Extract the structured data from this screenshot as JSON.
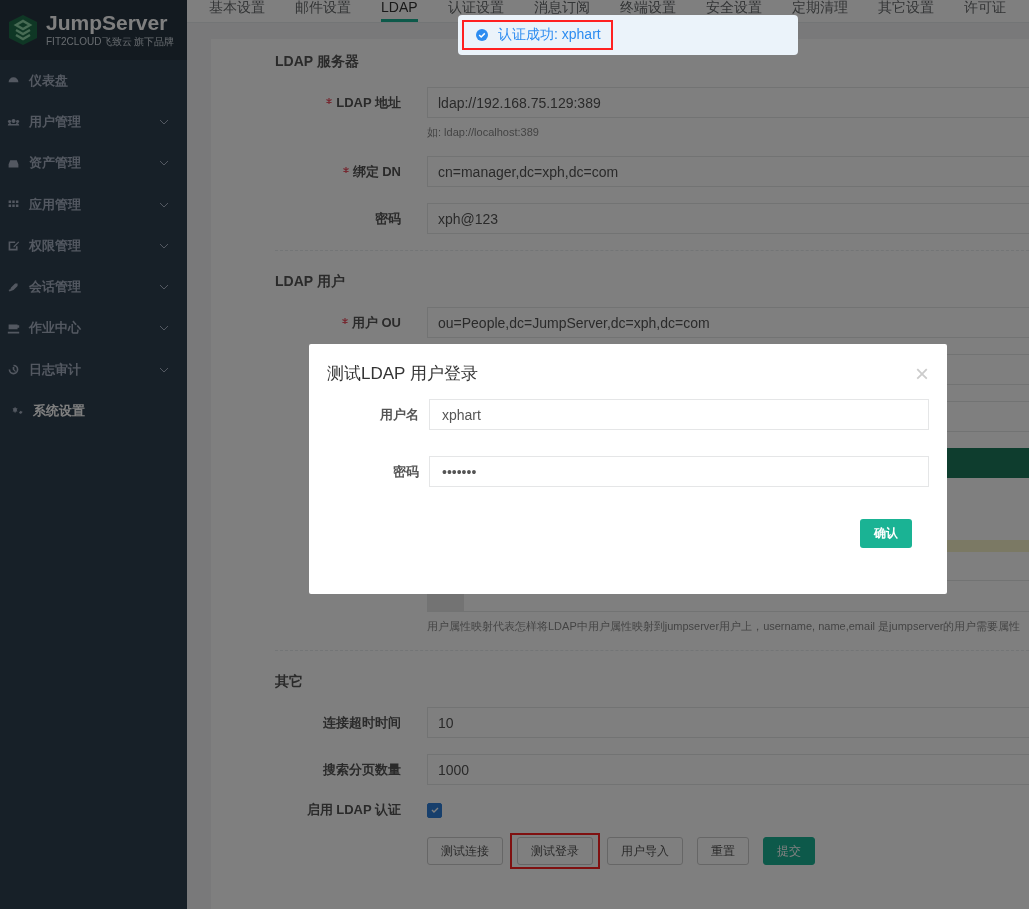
{
  "logo": {
    "name": "JumpServer",
    "tagline": "FIT2CLOUD飞致云 旗下品牌"
  },
  "sidebar": {
    "items": [
      {
        "label": "仪表盘",
        "expandable": false,
        "selected": false
      },
      {
        "label": "用户管理",
        "expandable": true,
        "selected": false
      },
      {
        "label": "资产管理",
        "expandable": true,
        "selected": false
      },
      {
        "label": "应用管理",
        "expandable": true,
        "selected": false
      },
      {
        "label": "权限管理",
        "expandable": true,
        "selected": false
      },
      {
        "label": "会话管理",
        "expandable": true,
        "selected": false
      },
      {
        "label": "作业中心",
        "expandable": true,
        "selected": false
      },
      {
        "label": "日志审计",
        "expandable": true,
        "selected": false
      },
      {
        "label": "系统设置",
        "expandable": false,
        "selected": true
      }
    ]
  },
  "tabs": [
    {
      "label": "基本设置",
      "selected": false
    },
    {
      "label": "邮件设置",
      "selected": false
    },
    {
      "label": "LDAP",
      "selected": true
    },
    {
      "label": "认证设置",
      "selected": false
    },
    {
      "label": "消息订阅",
      "selected": false
    },
    {
      "label": "终端设置",
      "selected": false
    },
    {
      "label": "安全设置",
      "selected": false
    },
    {
      "label": "定期清理",
      "selected": false
    },
    {
      "label": "其它设置",
      "selected": false
    },
    {
      "label": "许可证",
      "selected": false
    }
  ],
  "sections": [
    {
      "title": "LDAP 服务器",
      "fields": [
        {
          "label": "LDAP 地址",
          "required": true,
          "value": "ldap://192.168.75.129:389",
          "help": "如: ldap://localhost:389"
        },
        {
          "label": "绑定 DN",
          "required": true,
          "value": "cn=manager,dc=xph,dc=com"
        },
        {
          "label": "密码",
          "required": false,
          "value": "xph@123"
        }
      ]
    },
    {
      "title": "LDAP 用户",
      "fields": [
        {
          "label": "用户 OU",
          "required": true,
          "value": "ou=People,dc=JumpServer,dc=xph,dc=com"
        }
      ],
      "mapping_help": "用户属性映射代表怎样将LDAP中用户属性映射到jumpserver用户上，username, name,email 是jumpserver的用户需要属性"
    },
    {
      "title": "其它",
      "fields": [
        {
          "label": "连接超时时间",
          "required": false,
          "value": "10"
        },
        {
          "label": "搜索分页数量",
          "required": false,
          "value": "1000"
        }
      ],
      "toggle": {
        "label": "启用 LDAP 认证",
        "checked": true
      }
    }
  ],
  "buttons": [
    {
      "label": "测试连接",
      "kind": "default",
      "highlighted": false
    },
    {
      "label": "测试登录",
      "kind": "default",
      "highlighted": true
    },
    {
      "label": "用户导入",
      "kind": "default",
      "highlighted": false
    },
    {
      "label": "重置",
      "kind": "default",
      "highlighted": false
    },
    {
      "label": "提交",
      "kind": "primary",
      "highlighted": false
    }
  ],
  "dialog": {
    "title": "测试LDAP 用户登录",
    "close": "×",
    "fields": [
      {
        "label": "用户名",
        "value": "xphart"
      },
      {
        "label": "密码",
        "value": "•••••••"
      }
    ],
    "confirm": "确认"
  },
  "toast": {
    "message": "认证成功: xphart",
    "highlighted": true
  }
}
